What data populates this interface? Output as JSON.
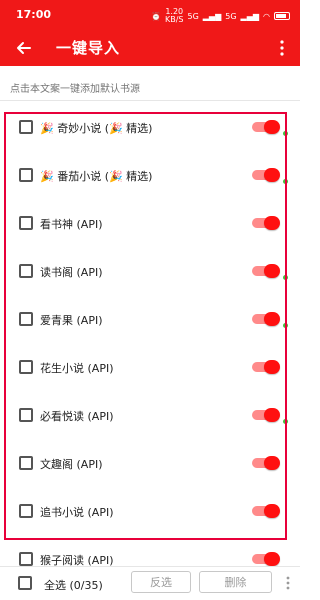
{
  "status_bar": {
    "time": "17:00",
    "speed_value": "1.20",
    "speed_unit": "KB/S",
    "network1": "5G",
    "network2": "5G",
    "battery_level": "60"
  },
  "toolbar": {
    "title": "一键导入",
    "back_icon": "arrow-left-icon",
    "more_icon": "more-vert-icon",
    "bg_color": "#f01818"
  },
  "hint": "点击本文案一键添加默认书源",
  "sources": [
    {
      "label": "🎉 奇妙小说 (🎉 精选)",
      "checked": false,
      "enabled": true,
      "status_dot": true
    },
    {
      "label": "🎉 番茄小说 (🎉 精选)",
      "checked": false,
      "enabled": true,
      "status_dot": true
    },
    {
      "label": "看书神 (API)",
      "checked": false,
      "enabled": true,
      "status_dot": false
    },
    {
      "label": "读书阁 (API)",
      "checked": false,
      "enabled": true,
      "status_dot": true
    },
    {
      "label": "爱青果 (API)",
      "checked": false,
      "enabled": true,
      "status_dot": true
    },
    {
      "label": "花生小说 (API)",
      "checked": false,
      "enabled": true,
      "status_dot": false
    },
    {
      "label": "必看悦读 (API)",
      "checked": false,
      "enabled": true,
      "status_dot": true
    },
    {
      "label": "文趣阁 (API)",
      "checked": false,
      "enabled": true,
      "status_dot": false
    },
    {
      "label": "追书小说 (API)",
      "checked": false,
      "enabled": true,
      "status_dot": false
    },
    {
      "label": "猴子阅读 (API)",
      "checked": false,
      "enabled": true,
      "status_dot": false
    }
  ],
  "bottom_bar": {
    "select_all_label": "全选 (0/35)",
    "invert_label": "反选",
    "delete_label": "删除"
  },
  "colors": {
    "accent": "#f01818",
    "switch_thumb": "#ff1010",
    "switch_track": "#ff8a8a",
    "status_dot": "#3fbf3f",
    "highlight_border": "#e8003a"
  }
}
